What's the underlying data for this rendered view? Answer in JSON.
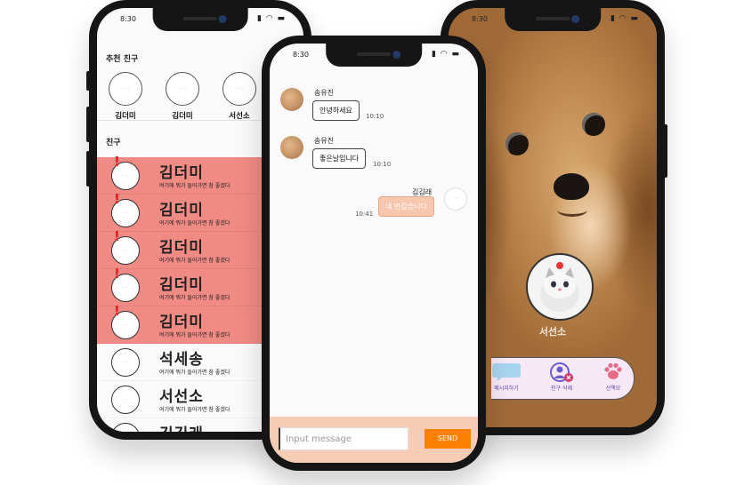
{
  "status_bar": {
    "time": "8:30",
    "icons": "▮ ◠ ▬"
  },
  "friends_screen": {
    "recommended_label": "추천 친구",
    "recommended": [
      {
        "name": "김더미"
      },
      {
        "name": "김더미"
      },
      {
        "name": "서선소"
      }
    ],
    "friends_label": "친구",
    "friends": [
      {
        "name": "김더미",
        "status": "여기에 뭐가 들어가면 참 좋겠다",
        "alert": true
      },
      {
        "name": "김더미",
        "status": "여기에 뭐가 들어가면 참 좋겠다",
        "alert": true
      },
      {
        "name": "김더미",
        "status": "여기에 뭐가 들어가면 참 좋겠다",
        "alert": true
      },
      {
        "name": "김더미",
        "status": "여기에 뭐가 들어가면 참 좋겠다",
        "alert": true
      },
      {
        "name": "김더미",
        "status": "여기에 뭐가 들어가면 참 좋겠다",
        "alert": true
      },
      {
        "name": "석세송",
        "status": "여기에 뭐가 들어가면 참 좋겠다",
        "alert": false
      },
      {
        "name": "서선소",
        "status": "여기에 뭐가 들어가면 참 좋겠다",
        "alert": false
      },
      {
        "name": "김김래",
        "status": "",
        "alert": false
      }
    ],
    "alert_color": "#f08a84"
  },
  "chat_screen": {
    "messages": [
      {
        "sender": "송유진",
        "text": "안녕하세요",
        "time": "10:10"
      },
      {
        "sender": "송유진",
        "text": "좋은날입니다",
        "time": "10:10"
      }
    ],
    "my_message": {
      "sender": "김김래",
      "text": "네 반갑습니다",
      "time": "10:41"
    },
    "input_placeholder": "Input message",
    "send_label": "SEND",
    "accent_color": "#ff7f00"
  },
  "profile_screen": {
    "name": "서선소",
    "actions": [
      {
        "label": "메시지하기",
        "icon": "chat-bubble-icon"
      },
      {
        "label": "친구 삭제",
        "icon": "remove-friend-icon"
      },
      {
        "label": "산책모",
        "icon": "paw-icon"
      }
    ]
  }
}
